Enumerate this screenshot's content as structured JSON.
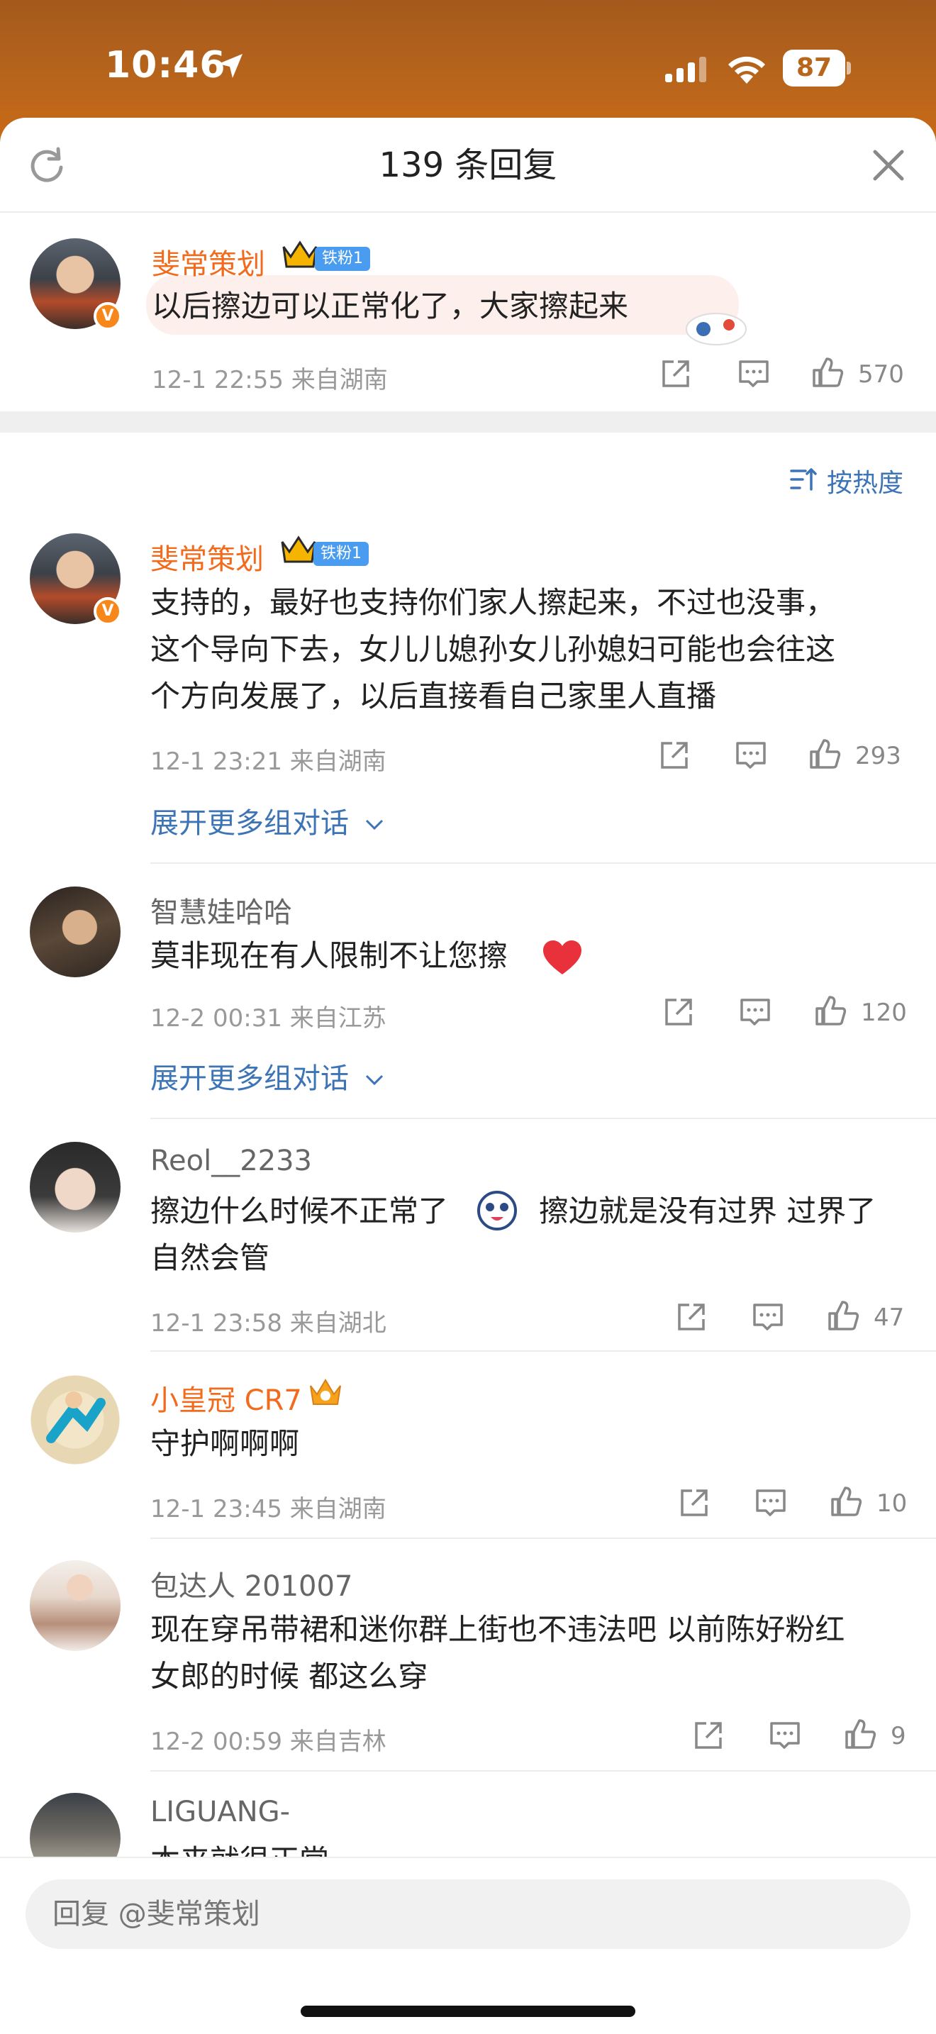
{
  "status_bar": {
    "time": "10:46",
    "battery": "87"
  },
  "header": {
    "title": "139 条回复",
    "refresh_icon": "refresh-icon",
    "close_icon": "close-icon"
  },
  "sort": {
    "label": "按热度"
  },
  "fan_badge": "铁粉1",
  "root_comment": {
    "author": "斐常策划",
    "text": "以后擦边可以正常化了，大家擦起来",
    "meta": "12-1 22:55  来自湖南",
    "likes": "570"
  },
  "comments": [
    {
      "author": "斐常策划",
      "text_lines": [
        "支持的，最好也支持你们家人擦起来，不过也没事，",
        "这个导向下去，女儿儿媳孙女儿孙媳妇可能也会往这",
        "个方向发展了，以后直接看自己家里人直播"
      ],
      "meta": "12-1 23:21  来自湖南",
      "likes": "293",
      "expand": "展开更多组对话"
    },
    {
      "author": "智慧娃哈哈",
      "text": "莫非现在有人限制不让您擦",
      "meta": "12-2 00:31  来自江苏",
      "likes": "120",
      "expand": "展开更多组对话"
    },
    {
      "author": "Reol__2233",
      "text_part1": "擦边什么时候不正常了",
      "text_part2": "擦边就是没有过界 过界了",
      "text_line2": "自然会管",
      "meta": "12-1 23:58  来自湖北",
      "likes": "47"
    },
    {
      "author": "小皇冠 CR7",
      "text": "守护啊啊啊",
      "meta": "12-1 23:45  来自湖南",
      "likes": "10"
    },
    {
      "author": "包达人 201007",
      "text_lines": [
        "现在穿吊带裙和迷你群上街也不违法吧 以前陈好粉红",
        "女郎的时候 都这么穿"
      ],
      "meta": "12-2 00:59  来自吉林",
      "likes": "9"
    },
    {
      "author": "LIGUANG-",
      "text": "本来就很正常"
    }
  ],
  "reply_bar": {
    "placeholder": "回复 @斐常策划"
  },
  "colors": {
    "accent_orange": "#f26b1d",
    "link_blue": "#3d74b5",
    "fan_badge_blue": "#4a9cf0"
  }
}
